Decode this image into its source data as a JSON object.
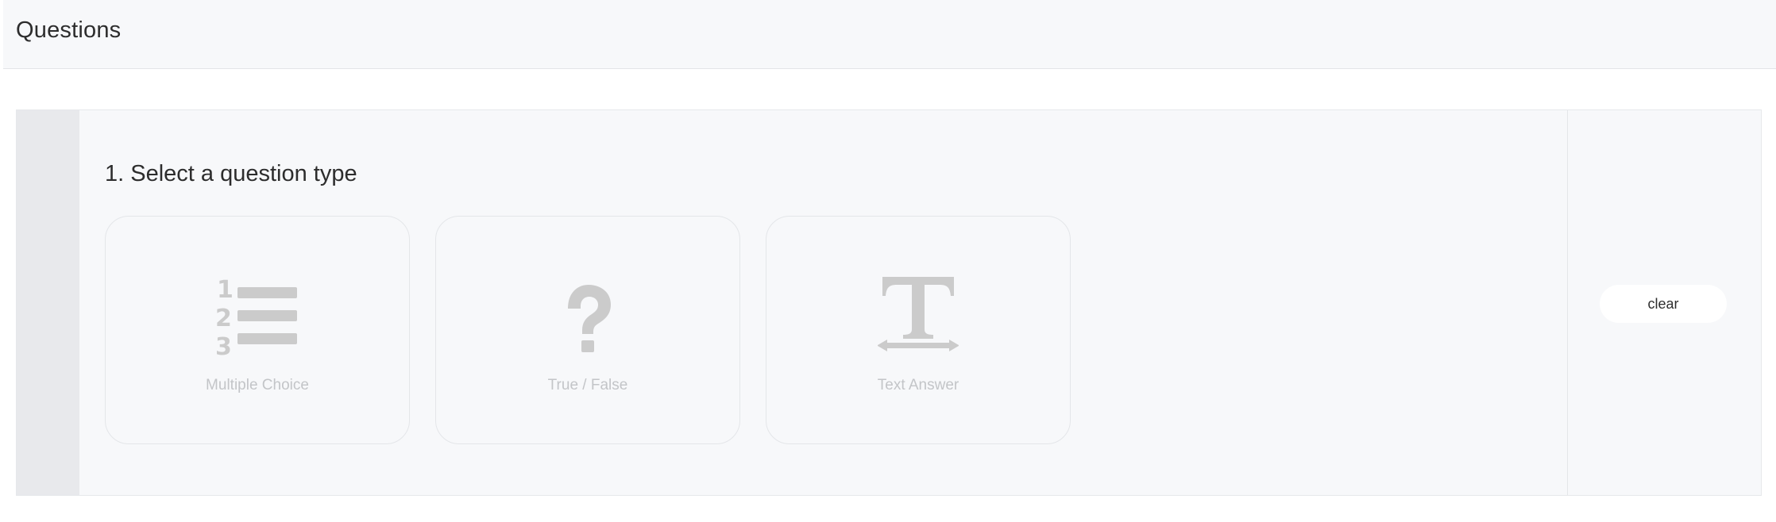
{
  "header": {
    "title": "Questions"
  },
  "question_block": {
    "step_title": "1. Select a question type",
    "types": [
      {
        "label": "Multiple Choice",
        "icon": "numbered-list-icon"
      },
      {
        "label": "True / False",
        "icon": "question-mark-icon"
      },
      {
        "label": "Text Answer",
        "icon": "text-type-icon"
      }
    ],
    "clear_label": "clear"
  },
  "colors": {
    "panel_background": "#f7f8fa",
    "drag_strip": "#e8e9ec",
    "icon_gray": "#cbcbcb",
    "muted_label": "#c3c5c8"
  }
}
